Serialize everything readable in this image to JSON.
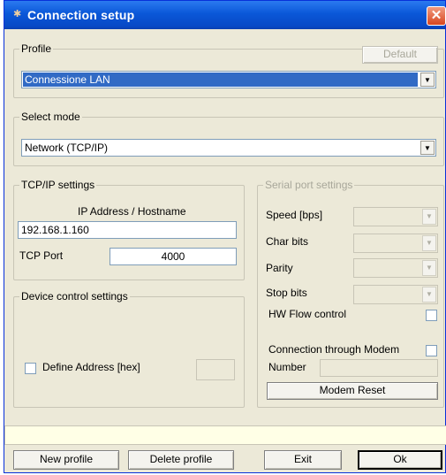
{
  "window": {
    "title": "Connection setup",
    "close_glyph": "✕",
    "title_icon": "✱"
  },
  "profile": {
    "legend": "Profile",
    "default_button": "Default",
    "selected": "Connessione LAN"
  },
  "select_mode": {
    "legend": "Select mode",
    "selected": "Network (TCP/IP)"
  },
  "tcpip": {
    "legend": "TCP/IP settings",
    "ip_label": "IP Address / Hostname",
    "ip_value": "192.168.1.160",
    "port_label": "TCP Port",
    "port_value": "4000"
  },
  "device_control": {
    "legend": "Device control settings",
    "define_address_label": "Define Address [hex]",
    "address_value": ""
  },
  "serial": {
    "legend": "Serial port settings",
    "speed_label": "Speed [bps]",
    "char_bits_label": "Char bits",
    "parity_label": "Parity",
    "stop_bits_label": "Stop bits",
    "hw_flow_label": "HW Flow control",
    "modem_label": "Connection through Modem",
    "number_label": "Number",
    "number_value": "",
    "modem_reset_button": "Modem Reset"
  },
  "status": {
    "text": ""
  },
  "footer": {
    "new_profile": "New profile",
    "delete_profile": "Delete profile",
    "exit": "Exit",
    "ok": "Ok"
  },
  "arrow_glyph": "▼",
  "colors": {
    "titlebar": "#0a57d8",
    "face": "#ece9d8",
    "selection": "#316ac5",
    "close": "#d8461f"
  }
}
